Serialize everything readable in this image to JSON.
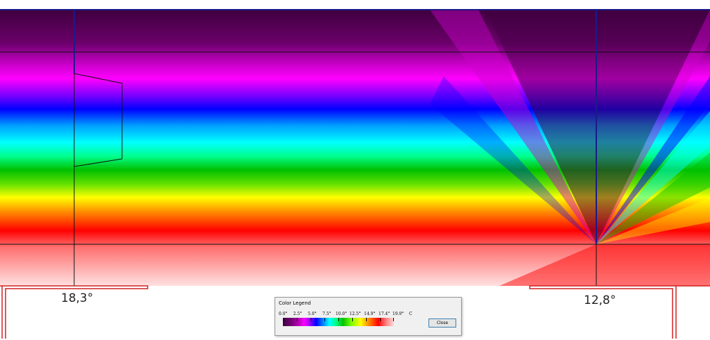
{
  "labels": {
    "left_temp": "18,3°",
    "right_temp": "12,8°"
  },
  "legend": {
    "title": "Color Legend",
    "ticks": [
      "0.0°",
      "2.5°",
      "5.0°",
      "7.5°",
      "10.0°",
      "12.5°",
      "14.9°",
      "17.4°",
      "19.9°"
    ],
    "unit": "C",
    "close_label": "Close",
    "colors": [
      "#3a003a",
      "#ff00ff",
      "#0000ff",
      "#00ffff",
      "#00c000",
      "#ffff00",
      "#ff0000",
      "#ffdada"
    ]
  }
}
